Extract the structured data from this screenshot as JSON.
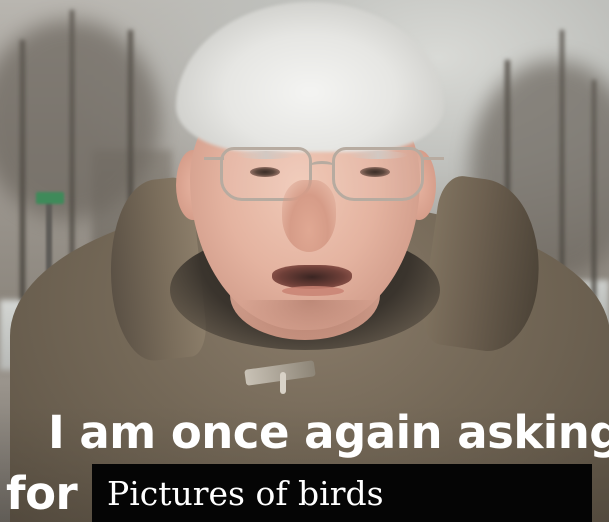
{
  "meme": {
    "caption_line_1": "I am once again asking",
    "caption_line_2": "for",
    "overlay_text": "Pictures of birds"
  },
  "colors": {
    "caption_text": "#ffffff",
    "overlay_box": "#050505",
    "jacket": "#746857",
    "skin": "#e4b3a0",
    "hair": "#e6e6e3"
  }
}
